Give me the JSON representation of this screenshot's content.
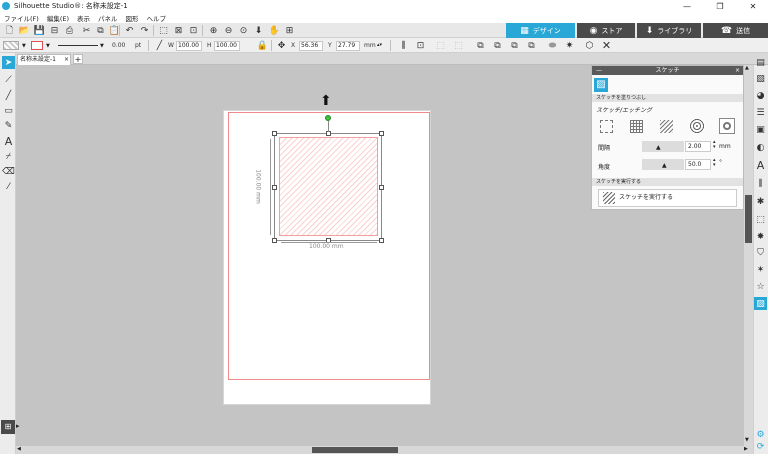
{
  "titlebar": {
    "title": "Silhouette Studio®: 名称未設定-1",
    "minimize": "—",
    "maximize": "❐",
    "close": "✕"
  },
  "menu": [
    "ファイル(F)",
    "編集(E)",
    "表示",
    "パネル",
    "図形",
    "ヘルプ"
  ],
  "nav_tabs": {
    "design": "デザイン",
    "store": "ストア",
    "library": "ライブラリ",
    "send": "送信"
  },
  "toolbar2": {
    "line_width": "0.00",
    "line_unit": "pt",
    "w_label": "W",
    "w_value": "100.00",
    "h_label": "H",
    "h_value": "100.00",
    "x_label": "X",
    "x_value": "56.36",
    "y_label": "Y",
    "y_value": "27.79",
    "unit": "mm"
  },
  "doc_tab": {
    "name": "名称未設定-1",
    "close": "×",
    "add": "+"
  },
  "dimensions": {
    "width": "100.00 mm",
    "height": "100.00 mm"
  },
  "sketch_panel": {
    "header": "スケッチ",
    "section1": "スケッチを塗りつぶし",
    "subtitle": "スケッチ/エッチング",
    "spacing_label": "間隔",
    "spacing_value": "2.00",
    "spacing_unit": "mm",
    "angle_label": "角度",
    "angle_value": "50.0",
    "angle_unit": "°",
    "section2": "スケッチを実行する",
    "run_button": "スケッチを実行する"
  },
  "colors": {
    "accent": "#29a8d8",
    "cut_line": "#f08a8a",
    "nav_active": "#29a8d8"
  }
}
